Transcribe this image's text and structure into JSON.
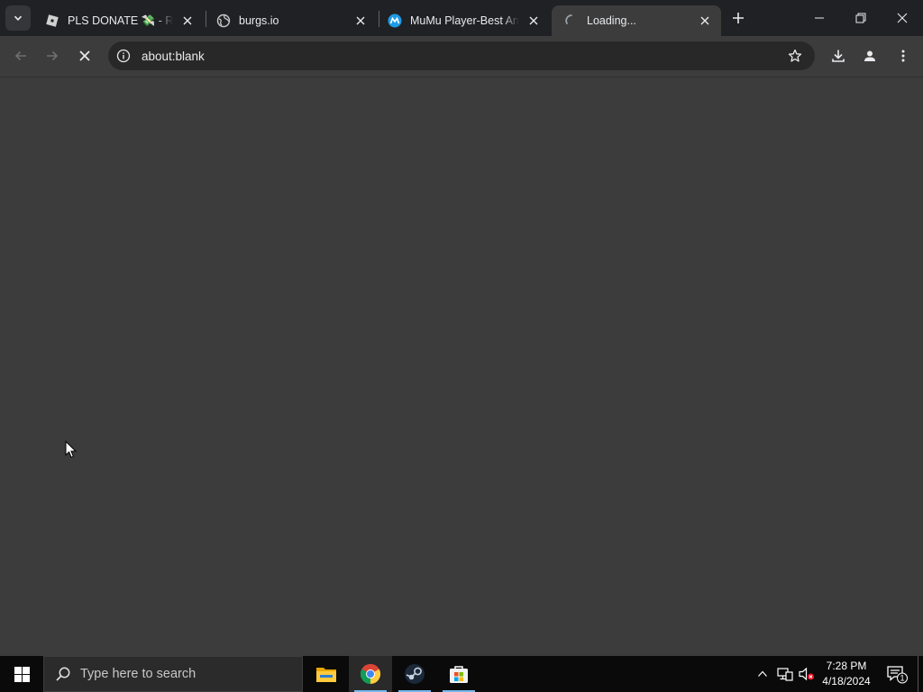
{
  "browser": {
    "tabs": [
      {
        "title": "PLS DONATE 💸 - Roblox",
        "favicon": "roblox-icon",
        "active": false
      },
      {
        "title": "burgs.io",
        "favicon": "globe-icon",
        "active": false
      },
      {
        "title": "MuMu Player-Best Android Emulator",
        "favicon": "mumu-icon",
        "active": false
      },
      {
        "title": "Loading...",
        "favicon": "loading-spinner-icon",
        "active": true
      }
    ],
    "address_bar": {
      "url": "about:blank",
      "icon": "info-icon"
    },
    "colors": {
      "frame": "#202124",
      "toolbar": "#3c3c3c",
      "omnibox": "#282828",
      "text": "#e8eaed"
    }
  },
  "taskbar": {
    "search_placeholder": "Type here to search",
    "apps": [
      "file-explorer-icon",
      "chrome-icon",
      "steam-icon",
      "microsoft-store-icon"
    ],
    "clock": {
      "time": "7:28 PM",
      "date": "4/18/2024"
    },
    "notification_count": "1"
  }
}
